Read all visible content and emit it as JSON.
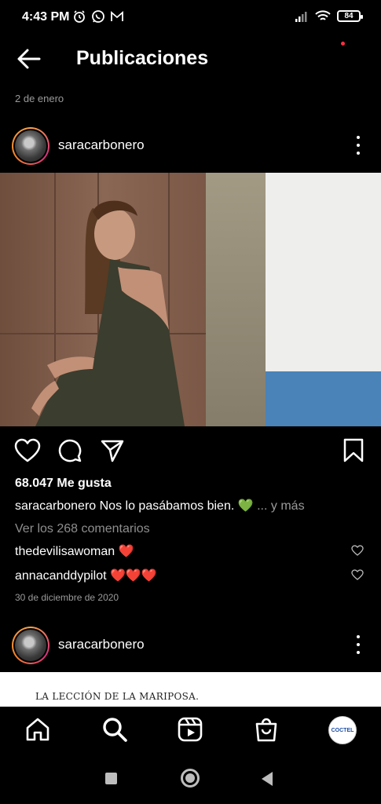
{
  "status": {
    "time": "4:43 PM",
    "battery": "84"
  },
  "header": {
    "title": "Publicaciones"
  },
  "feed": {
    "date_label": "2 de enero"
  },
  "post1": {
    "username": "saracarbonero",
    "likes": "68.047 Me gusta",
    "caption_user": "saracarbonero",
    "caption_text": "Nos lo pasábamos bien. 💚",
    "caption_more": "... y más",
    "view_comments": "Ver los 268 comentarios",
    "comments": [
      {
        "user": "thedevilisawoman",
        "text": "❤️"
      },
      {
        "user": "annacanddypilot",
        "text": "❤️❤️❤️"
      }
    ],
    "date": "30 de diciembre de 2020"
  },
  "post2": {
    "username": "saracarbonero",
    "image_text": "LA LECCIÓN DE LA MARIPOSA."
  },
  "bottom_nav": {
    "profile_badge": "COCTEL"
  },
  "colors": {
    "background": "#000000",
    "muted_text": "#9a9a9a",
    "notification": "#ff3040"
  }
}
